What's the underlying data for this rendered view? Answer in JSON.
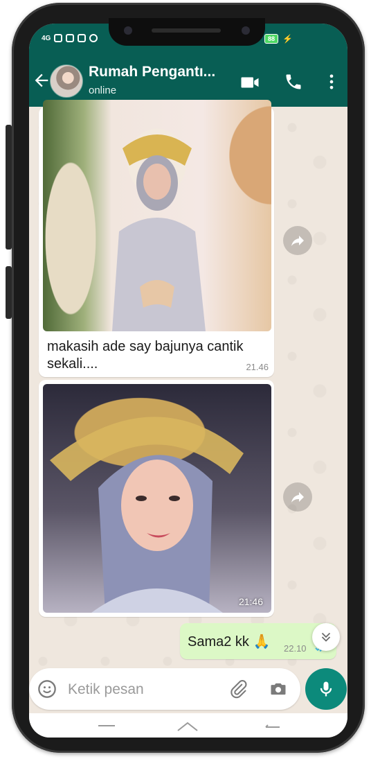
{
  "status_bar": {
    "network": "4G",
    "battery": "88"
  },
  "header": {
    "contact_name": "Rumah Pengantı...",
    "contact_status": "online"
  },
  "messages": [
    {
      "type": "incoming-image",
      "caption": "makasih ade say bajunya cantik sekali....",
      "time": "21.46"
    },
    {
      "type": "incoming-image",
      "caption": "",
      "time": "21:46"
    },
    {
      "type": "outgoing-text",
      "text": "Sama2 kk 🙏",
      "time": "22.10"
    }
  ],
  "input": {
    "placeholder": "Ketik pesan",
    "value": ""
  },
  "icons": {
    "back": "arrow-left-icon",
    "video_call": "video-camera-icon",
    "voice_call": "phone-icon",
    "menu": "more-vert-icon",
    "forward": "share-arrow-icon",
    "scroll_down": "double-chevron-down-icon",
    "emoji": "emoji-icon",
    "attach": "paperclip-icon",
    "camera": "camera-icon",
    "mic": "mic-icon"
  },
  "colors": {
    "header": "#085e54",
    "chat_background": "#efe7de",
    "outgoing_bubble": "#dcf8c6",
    "mic_button": "#0c8a7b"
  }
}
